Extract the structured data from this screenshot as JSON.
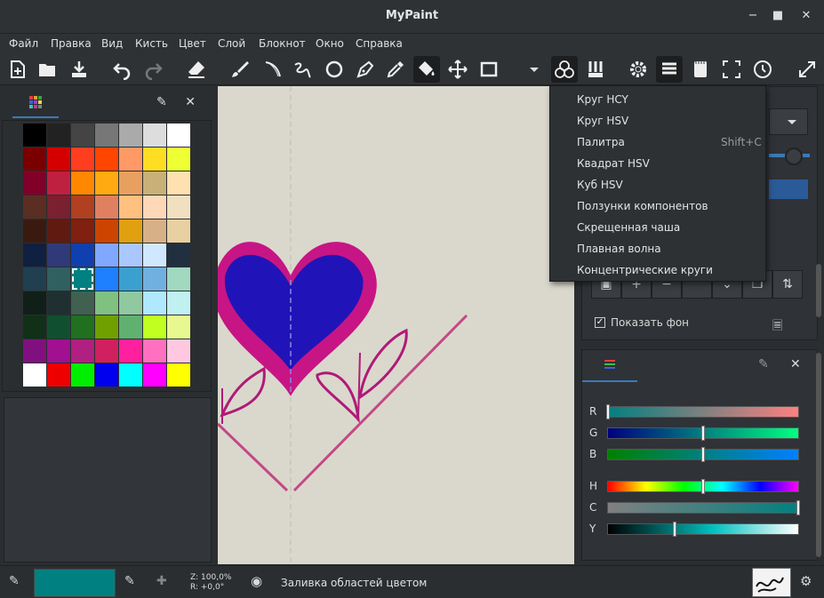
{
  "window": {
    "title": "MyPaint"
  },
  "menu": [
    "Файл",
    "Правка",
    "Вид",
    "Кисть",
    "Цвет",
    "Слой",
    "Блокнот",
    "Окно",
    "Справка"
  ],
  "toolbar": {
    "icons": [
      "new-document-icon",
      "open-document-icon",
      "save-icon",
      "undo-icon",
      "redo-icon",
      "eraser-icon",
      "brush-icon",
      "freehand-icon",
      "inking-icon",
      "ellipse-icon",
      "pen-icon",
      "color-picker-icon",
      "fill-icon",
      "move-icon",
      "frame-icon",
      "dropdown-icon",
      "color-wheels-icon",
      "brushes-icon",
      "settings-icon",
      "layers-icon",
      "scratchpad-icon",
      "fullscreen-icon",
      "history-icon",
      "expand-icon"
    ]
  },
  "palette": {
    "colors": [
      [
        "#000000",
        "#222222",
        "#444444",
        "#777777",
        "#aaaaaa",
        "#dddddd",
        "#ffffff"
      ],
      [
        "#7a0000",
        "#d40000",
        "#ff3e20",
        "#ff4500",
        "#ff9966",
        "#ffdd22",
        "#eeff33"
      ],
      [
        "#80002a",
        "#c02040",
        "#ff8800",
        "#ffaa11",
        "#e8a060",
        "#c8b078",
        "#ffe0b0"
      ],
      [
        "#5a2e22",
        "#7a2030",
        "#b04020",
        "#e08060",
        "#ffc080",
        "#ffd8b8",
        "#f0e0c0"
      ],
      [
        "#3a1a10",
        "#601a10",
        "#802010",
        "#cc4400",
        "#e0a010",
        "#d8b088",
        "#e8d0a0"
      ],
      [
        "#102040",
        "#303a78",
        "#1040b0",
        "#80a8ff",
        "#aac8ff",
        "#d0e8ff",
        "#203040"
      ],
      [
        "#204050",
        "#306060",
        "#008080",
        "#1f7fff",
        "#3aa0d0",
        "#70b0e0",
        "#a0d8c0"
      ],
      [
        "#102018",
        "#203030",
        "#406050",
        "#80c080",
        "#90c8a0",
        "#b0e8ff",
        "#c0f0f0"
      ],
      [
        "#103018",
        "#105030",
        "#207020",
        "#70a000",
        "#60b070",
        "#c0ff20",
        "#e8f890"
      ],
      [
        "#801080",
        "#a01090",
        "#b02080",
        "#d02060",
        "#ff20a0",
        "#ff70c0",
        "#ffc8e0"
      ],
      [
        "#ffffff",
        "#ee0000",
        "#00ee00",
        "#0000ee",
        "#00ffff",
        "#ff00ff",
        "#ffff00"
      ]
    ]
  },
  "popup": {
    "items": [
      {
        "label": "Круг HCY",
        "shortcut": ""
      },
      {
        "label": "Круг HSV",
        "shortcut": ""
      },
      {
        "label": "Палитра",
        "shortcut": "Shift+C"
      },
      {
        "label": "Квадрат HSV",
        "shortcut": ""
      },
      {
        "label": "Куб HSV",
        "shortcut": ""
      },
      {
        "label": "Ползунки компонентов",
        "shortcut": ""
      },
      {
        "label": "Скрещенная чаша",
        "shortcut": ""
      },
      {
        "label": "Плавная волна",
        "shortcut": ""
      },
      {
        "label": "Концентрические круги",
        "shortcut": ""
      }
    ]
  },
  "layers": {
    "show_background_label": "Показать фон"
  },
  "components": {
    "sliders": [
      {
        "label": "R",
        "value": 0.0,
        "from": "#008080",
        "to": "#ff8080"
      },
      {
        "label": "G",
        "value": 0.5,
        "from": "#000080",
        "to": "#00ff80"
      },
      {
        "label": "B",
        "value": 0.5,
        "from": "#008000",
        "to": "#0080ff"
      },
      {
        "label": "H",
        "value": 0.5,
        "gradient": "hue"
      },
      {
        "label": "C",
        "value": 1.0,
        "from": "#808080",
        "to": "#008080"
      },
      {
        "label": "Y",
        "value": 0.35,
        "from": "#000000",
        "to": "#ffffff",
        "mid": "#00c0c0"
      }
    ]
  },
  "status": {
    "current_color": "#008080",
    "zoom": "Z: 100,0%",
    "rotation": "R: +0,0°",
    "tool_text": "Заливка областей цветом"
  }
}
